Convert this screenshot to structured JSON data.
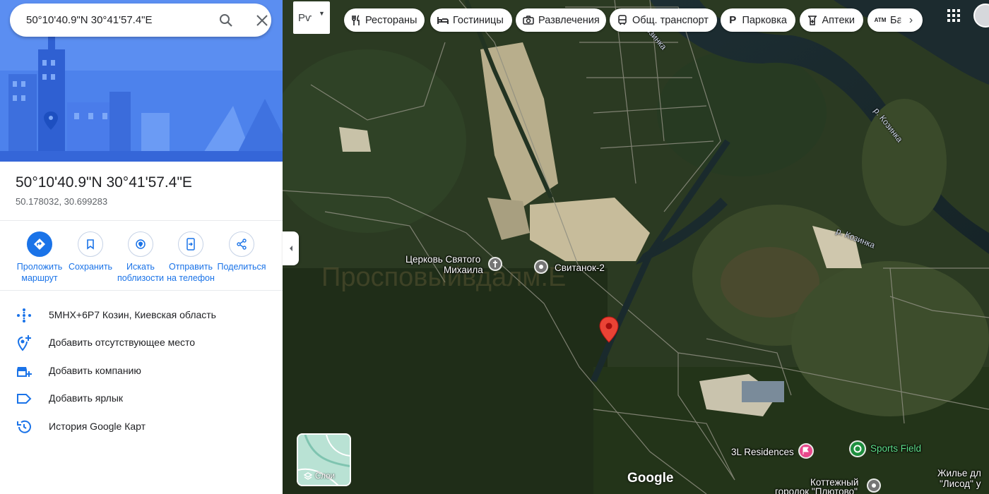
{
  "search": {
    "value": "50°10'40.9\"N 30°41'57.4\"E",
    "search_icon": "search-icon",
    "clear_icon": "close-icon"
  },
  "place": {
    "title": "50°10'40.9\"N 30°41'57.4\"E",
    "decimal": "50.178032, 30.699283"
  },
  "actions": [
    {
      "name": "directions",
      "label1": "Проложить",
      "label2": "маршрут",
      "icon": "directions-icon"
    },
    {
      "name": "save",
      "label1": "Сохранить",
      "label2": "",
      "icon": "bookmark-icon"
    },
    {
      "name": "nearby",
      "label1": "Искать",
      "label2": "поблизости",
      "icon": "nearby-icon"
    },
    {
      "name": "send",
      "label1": "Отправить",
      "label2": "на телефон",
      "icon": "send-to-phone-icon"
    },
    {
      "name": "share",
      "label1": "Поделиться",
      "label2": "",
      "icon": "share-icon"
    }
  ],
  "info": [
    {
      "text": "5MHX+6P7 Козин, Киевская область",
      "icon": "plus-code-icon"
    },
    {
      "text": "Добавить отсутствующее место",
      "icon": "add-place-icon"
    },
    {
      "text": "Добавить компанию",
      "icon": "add-business-icon"
    },
    {
      "text": "Добавить ярлык",
      "icon": "label-icon"
    },
    {
      "text": "История Google Карт",
      "icon": "history-icon"
    }
  ],
  "lang_button": "Рѵ",
  "chips": [
    {
      "label": "Рестораны",
      "icon": "restaurant-icon"
    },
    {
      "label": "Гостиницы",
      "icon": "hotel-icon"
    },
    {
      "label": "Развлечения",
      "icon": "camera-icon"
    },
    {
      "label": "Общ. транспорт",
      "icon": "transit-icon"
    },
    {
      "label": "Парковка",
      "icon": "parking-icon"
    },
    {
      "label": "Аптеки",
      "icon": "pharmacy-icon"
    },
    {
      "label": "Ба",
      "icon": "atm-icon"
    }
  ],
  "layers_label": "Слои",
  "map_labels": {
    "church_1": "Церковь Святого",
    "church_2": "Михаила",
    "svitanok": "Свитанок-2",
    "residences": "3L Residences",
    "sports": "Sports Field",
    "cottage_1": "Коттежный",
    "cottage_2": "городок \"Плютово\"",
    "housing_1": "Жилье дл",
    "housing_2": "\"Лисод\" у",
    "river_1": "р. Козинка",
    "river_2": "р. Козинка",
    "river_3": "Козинка"
  },
  "google_logo": "Google",
  "colors": {
    "accent": "#1a73e8",
    "pin": "#ea4335",
    "poi_pink": "#e8478b",
    "poi_green": "#1e8e3e"
  }
}
